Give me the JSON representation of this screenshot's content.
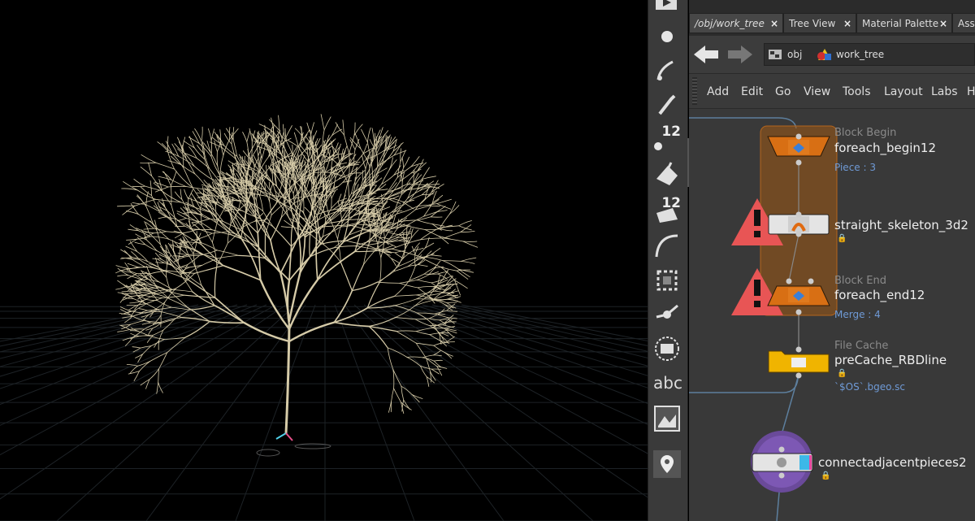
{
  "tabs": [
    {
      "label": "/obj/work_tree",
      "close": "×"
    },
    {
      "label": "Tree View",
      "close": "×"
    },
    {
      "label": "Material Palette",
      "close": "×"
    },
    {
      "label": "Asse",
      "close": ""
    }
  ],
  "path": {
    "root": "obj",
    "current": "work_tree"
  },
  "menu": [
    "Add",
    "Edit",
    "Go",
    "View",
    "Tools",
    "Layout",
    "Labs",
    "H"
  ],
  "shelf": {
    "tool_numbers": [
      "12",
      "12"
    ],
    "text_tool": "abc"
  },
  "nodes": {
    "block_begin": {
      "type": "Block Begin",
      "name": "foreach_begin12",
      "info": "Piece : 3"
    },
    "skeleton": {
      "name": "straight_skeleton_3d2"
    },
    "block_end": {
      "type": "Block End",
      "name": "foreach_end12",
      "info": "Merge : 4"
    },
    "file_cache": {
      "type": "File Cache",
      "name": "preCache_RBDline",
      "info": "`$OS`.bgeo.sc"
    },
    "connect": {
      "name": "connectadjacentpieces2"
    }
  },
  "colors": {
    "tree": "#d6cba8",
    "node_orange": "#d86f14",
    "node_yellow": "#f0b400",
    "warning": "#e85555",
    "block_frame": "#b5651d",
    "param_blue": "#6f9ad6"
  }
}
